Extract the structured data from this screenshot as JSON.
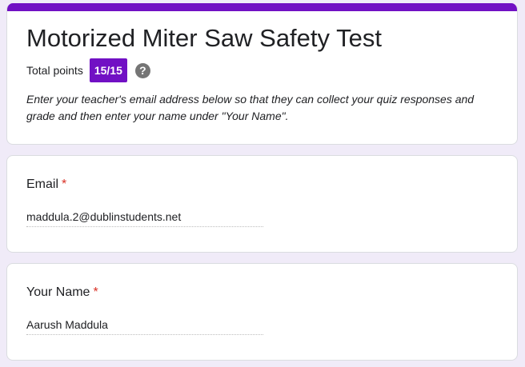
{
  "form": {
    "title": "Motorized Miter Saw Safety Test",
    "total_points_label": "Total points",
    "score": "15/15",
    "help_icon_glyph": "?",
    "description": "Enter your teacher's email address below so that they can collect your quiz responses and grade and then enter your name under \"Your Name\".",
    "accent_color": "#7110c4"
  },
  "questions": [
    {
      "title": "Email",
      "required_marker": "*",
      "answer": "maddula.2@dublinstudents.net"
    },
    {
      "title": "Your Name",
      "required_marker": "*",
      "answer": "Aarush Maddula"
    }
  ],
  "icons": {
    "help": "help-icon"
  }
}
